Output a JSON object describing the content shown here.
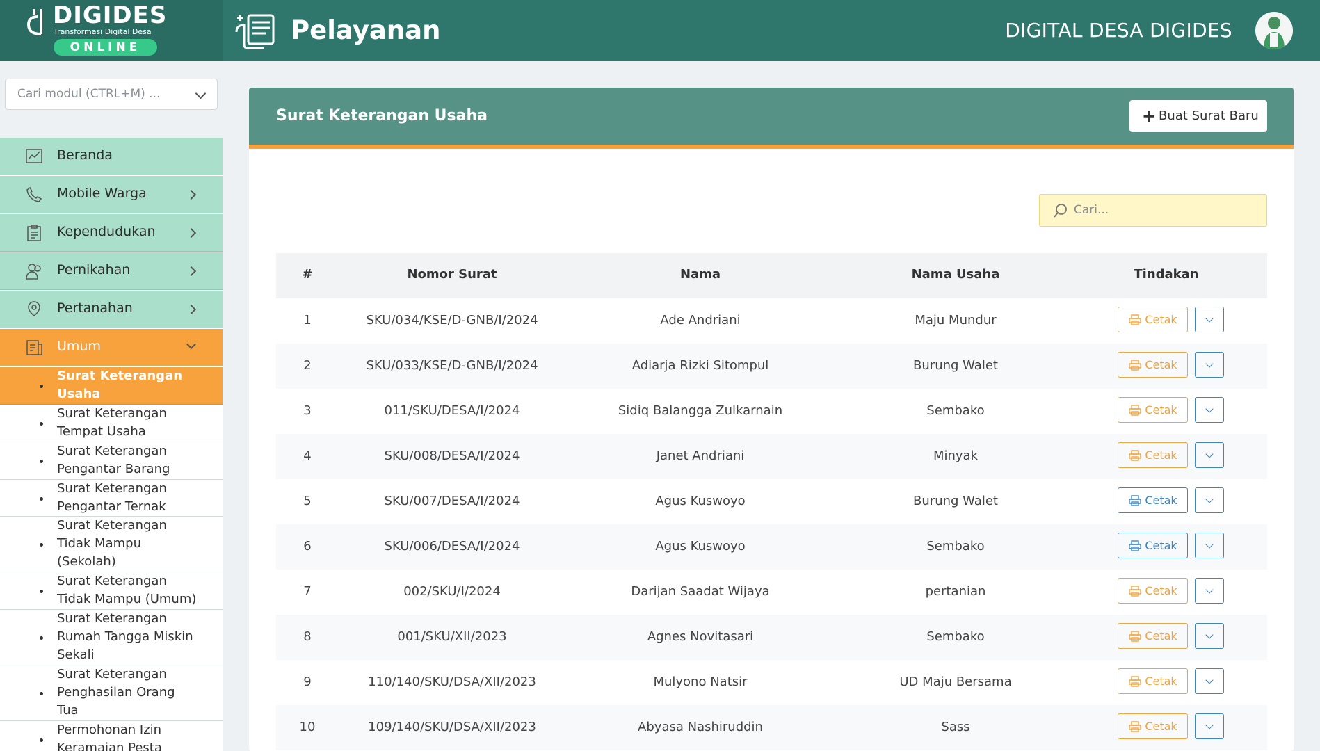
{
  "brand": {
    "title": "DIGIDES",
    "subtitle": "Transformasi Digital Desa",
    "online": "ONLINE",
    "right_text": "DIGITAL DESA DIGIDES"
  },
  "header": {
    "page_title": "Pelayanan"
  },
  "sidebar": {
    "search_placeholder": "Cari modul (CTRL+M) ...",
    "items": [
      {
        "label": "Beranda",
        "icon": "chart-icon"
      },
      {
        "label": "Mobile Warga",
        "icon": "phone-icon"
      },
      {
        "label": "Kependudukan",
        "icon": "clipboard-icon"
      },
      {
        "label": "Pernikahan",
        "icon": "people-icon"
      },
      {
        "label": "Pertanahan",
        "icon": "location-icon"
      },
      {
        "label": "Umum",
        "icon": "document-icon"
      }
    ],
    "subitems": [
      "Surat Keterangan Usaha",
      "Surat Keterangan Tempat Usaha",
      "Surat Keterangan Pengantar Barang",
      "Surat Keterangan Pengantar Ternak",
      "Surat Keterangan Tidak Mampu (Sekolah)",
      "Surat Keterangan Tidak Mampu (Umum)",
      "Surat Keterangan Rumah Tangga Miskin Sekali",
      "Surat Keterangan Penghasilan Orang Tua",
      "Permohonan Izin Keramaian Pesta"
    ],
    "sublines": [
      [
        "Surat Keterangan",
        "Usaha"
      ],
      [
        "Surat Keterangan",
        "Tempat Usaha"
      ],
      [
        "Surat Keterangan",
        "Pengantar Barang"
      ],
      [
        "Surat Keterangan",
        "Pengantar Ternak"
      ],
      [
        "Surat Keterangan",
        "Tidak Mampu",
        "(Sekolah)"
      ],
      [
        "Surat Keterangan",
        "Tidak Mampu (Umum)"
      ],
      [
        "Surat Keterangan",
        "Rumah Tangga Miskin",
        "Sekali"
      ],
      [
        "Surat Keterangan",
        "Penghasilan Orang",
        "Tua"
      ],
      [
        "Permohonan Izin",
        "Keramaian Pesta"
      ]
    ]
  },
  "card": {
    "title": "Surat Keterangan Usaha",
    "new_button": "Buat Surat Baru",
    "search_placeholder": "Cari..."
  },
  "table": {
    "headers": [
      "#",
      "Nomor Surat",
      "Nama",
      "Nama Usaha",
      "Tindakan"
    ],
    "print_label": "Cetak",
    "rows": [
      {
        "no": "1",
        "nomor": "SKU/034/KSE/D-GNB/I/2024",
        "nama": "Ade Andriani",
        "usaha": "Maju Mundur",
        "button_color": "orange"
      },
      {
        "no": "2",
        "nomor": "SKU/033/KSE/D-GNB/I/2024",
        "nama": "Adiarja Rizki Sitompul",
        "usaha": "Burung Walet",
        "button_color": "orange"
      },
      {
        "no": "3",
        "nomor": "011/SKU/DESA/I/2024",
        "nama": "Sidiq Balangga Zulkarnain",
        "usaha": "Sembako",
        "button_color": "orange"
      },
      {
        "no": "4",
        "nomor": "SKU/008/DESA/I/2024",
        "nama": "Janet Andriani",
        "usaha": "Minyak",
        "button_color": "orange"
      },
      {
        "no": "5",
        "nomor": "SKU/007/DESA/I/2024",
        "nama": "Agus Kuswoyo",
        "usaha": "Burung Walet",
        "button_color": "blue"
      },
      {
        "no": "6",
        "nomor": "SKU/006/DESA/I/2024",
        "nama": "Agus Kuswoyo",
        "usaha": "Sembako",
        "button_color": "blue"
      },
      {
        "no": "7",
        "nomor": "002/SKU/I/2024",
        "nama": "Darijan Saadat Wijaya",
        "usaha": "pertanian",
        "button_color": "orange"
      },
      {
        "no": "8",
        "nomor": "001/SKU/XII/2023",
        "nama": "Agnes Novitasari",
        "usaha": "Sembako",
        "button_color": "orange"
      },
      {
        "no": "9",
        "nomor": "110/140/SKU/DSA/XII/2023",
        "nama": "Mulyono Natsir",
        "usaha": "UD Maju Bersama",
        "button_color": "orange"
      },
      {
        "no": "10",
        "nomor": "109/140/SKU/DSA/XII/2023",
        "nama": "Abyasa Nashiruddin",
        "usaha": "Sass",
        "button_color": "orange"
      }
    ]
  },
  "colors": {
    "header": "#2f776c",
    "sidebar_item": "#a9dfcb",
    "active": "#f7a23c",
    "card_header": "#579286",
    "print_orange": "#f2a43d",
    "print_blue": "#3d86c6"
  }
}
